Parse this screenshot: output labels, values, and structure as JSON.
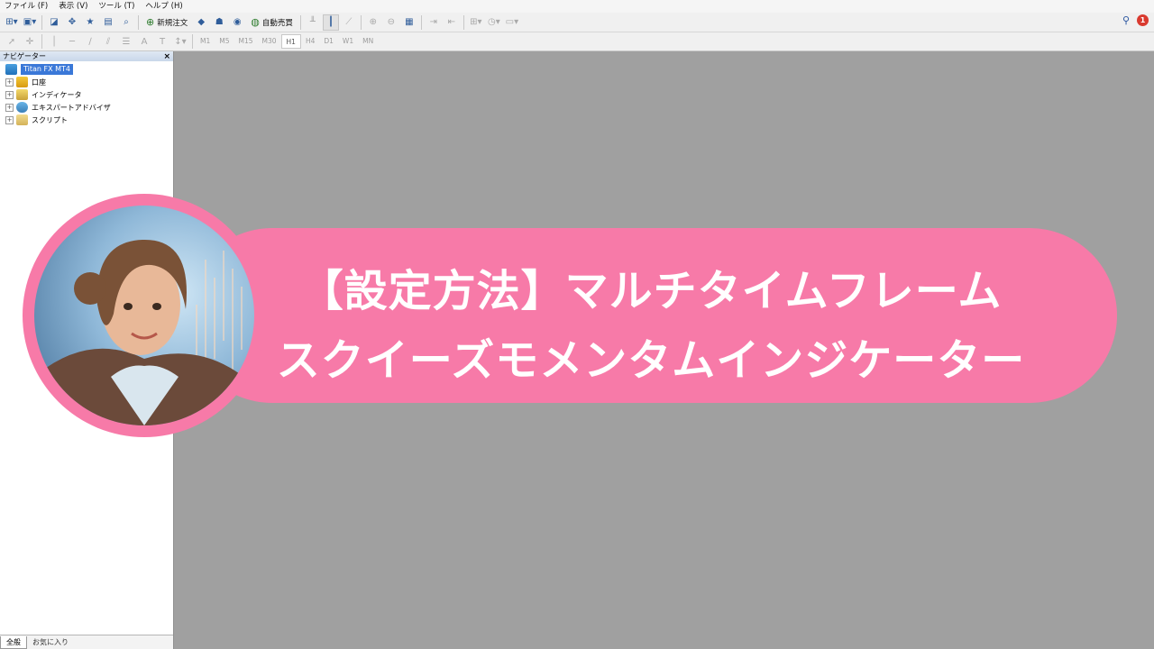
{
  "menubar": {
    "items": [
      "ファイル (F)",
      "表示 (V)",
      "ツール (T)",
      "ヘルプ (H)"
    ]
  },
  "toolbar1": {
    "new_order_label": "新規注文",
    "auto_trading_label": "自動売買",
    "alert_count": "1"
  },
  "toolbar2": {
    "timeframes": [
      "M1",
      "M5",
      "M15",
      "M30",
      "H1",
      "H4",
      "D1",
      "W1",
      "MN"
    ],
    "active_timeframe": "H1"
  },
  "navigator": {
    "title": "ナビゲーター",
    "root": "Titan FX MT4",
    "children": [
      "口座",
      "インディケータ",
      "エキスパートアドバイザ",
      "スクリプト"
    ],
    "tabs": [
      "全般",
      "お気に入り"
    ]
  },
  "banner": {
    "line1": "【設定方法】マルチタイムフレーム",
    "line2": "スクイーズモメンタムインジケーター"
  },
  "colors": {
    "banner": "#f77aa8",
    "workspace": "#a0a0a0",
    "selection": "#3a78d8"
  }
}
